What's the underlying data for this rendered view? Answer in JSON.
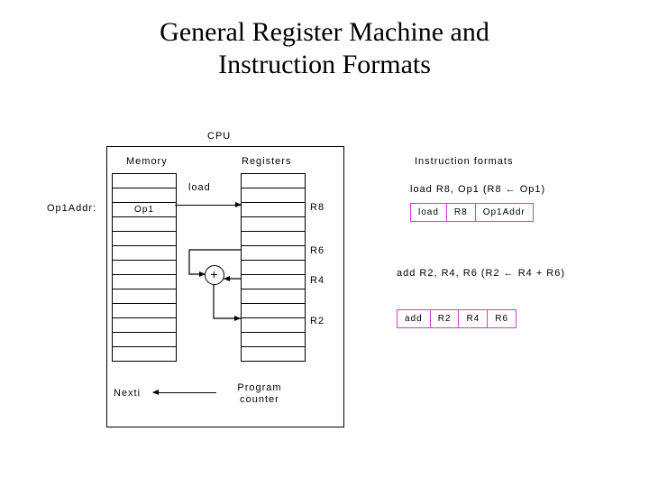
{
  "title_line1": "General Register Machine and",
  "title_line2": "Instruction Formats",
  "cpu": "CPU",
  "memory_label": "Memory",
  "registers_label": "Registers",
  "op1addr": "Op1Addr:",
  "op1": "Op1",
  "load": "load",
  "r8": "R8",
  "r6": "R6",
  "r4": "R4",
  "r2": "R2",
  "adder": "+",
  "nexti": "Nexti",
  "pc_l1": "Program",
  "pc_l2": "counter",
  "fmt_header": "Instruction formats",
  "fmt1_desc": "load R8, Op1 (R8 ← Op1)",
  "fmt1": {
    "c1": "load",
    "c2": "R8",
    "c3": "Op1Addr"
  },
  "fmt2_desc": "add R2, R4, R6 (R2 ← R4 + R6)",
  "fmt2": {
    "c1": "add",
    "c2": "R2",
    "c3": "R4",
    "c4": "R6"
  }
}
